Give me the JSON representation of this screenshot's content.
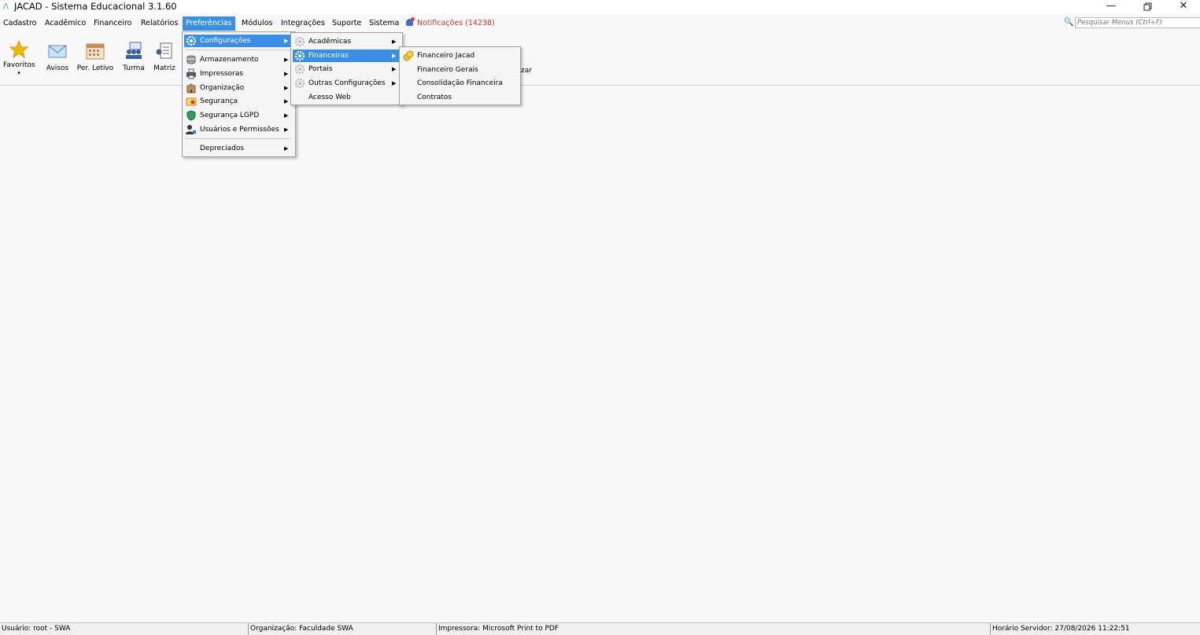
{
  "window": {
    "title": "JACAD - Sistema Educacional 3.1.60",
    "minimize_icon": "minimize-icon",
    "restore_icon": "restore-icon",
    "close_icon": "close-icon"
  },
  "menubar": {
    "items": [
      {
        "label": "Cadastro"
      },
      {
        "label": "Acadêmico"
      },
      {
        "label": "Financeiro"
      },
      {
        "label": "Relatórios"
      },
      {
        "label": "Preferências"
      },
      {
        "label": "Módulos"
      },
      {
        "label": "Integrações"
      },
      {
        "label": "Suporte"
      },
      {
        "label": "Sistema"
      }
    ],
    "notifications": "Notificações (14238)",
    "search_placeholder": "Pesquisar Menus (Ctrl+F)"
  },
  "toolbar": {
    "items": [
      {
        "label": "Favoritos",
        "icon": "star-icon"
      },
      {
        "label": "Avisos",
        "icon": "envelope-icon"
      },
      {
        "label": "Per. Letivo",
        "icon": "calendar-icon"
      },
      {
        "label": "Turma",
        "icon": "class-group-icon"
      },
      {
        "label": "Matriz",
        "icon": "curriculum-icon"
      }
    ],
    "partial_label": "zar"
  },
  "preferencias_menu": {
    "items": [
      {
        "label": "Configurações"
      },
      {
        "label": "Armazenamento"
      },
      {
        "label": "Impressoras"
      },
      {
        "label": "Organização"
      },
      {
        "label": "Segurança"
      },
      {
        "label": "Segurança LGPD"
      },
      {
        "label": "Usuários e Permissões"
      },
      {
        "label": "Depreciados"
      }
    ]
  },
  "configuracoes_menu": {
    "items": [
      {
        "label": "Acadêmicas"
      },
      {
        "label": "Financeiras"
      },
      {
        "label": "Portais"
      },
      {
        "label": "Outras Configurações"
      },
      {
        "label": "Acesso Web"
      }
    ]
  },
  "financeiras_menu": {
    "items": [
      {
        "label": "Financeiro Jacad"
      },
      {
        "label": "Financeiro Gerais"
      },
      {
        "label": "Consolidação Financeira"
      },
      {
        "label": "Contratos"
      }
    ]
  },
  "statusbar": {
    "user": "Usuário: root - SWA",
    "organization": "Organização: Faculdade SWA",
    "printer": "Impressora: Microsoft Print to PDF",
    "server_time": "Horário Servidor: 27/08/2026 11:22:51"
  }
}
